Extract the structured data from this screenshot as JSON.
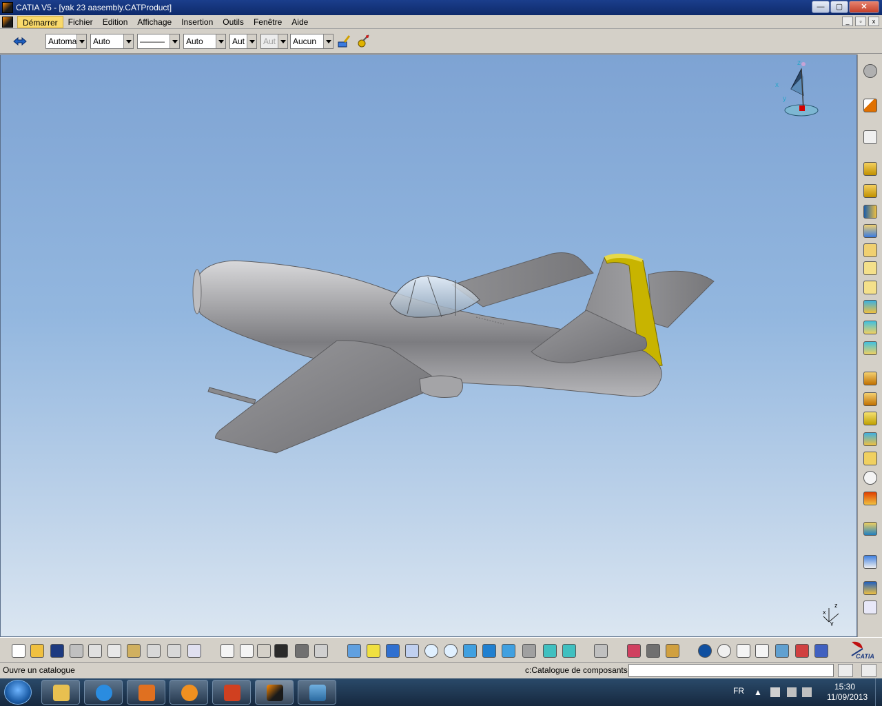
{
  "window": {
    "title": "CATIA V5 - [yak 23 aasembly.CATProduct]",
    "minimize": "—",
    "maximize": "▢",
    "close": "✕"
  },
  "menu": {
    "items": [
      "Démarrer",
      "Fichier",
      "Edition",
      "Affichage",
      "Insertion",
      "Outils",
      "Fenêtre",
      "Aide"
    ],
    "active_index": 0
  },
  "doc_controls": {
    "minimize": "_",
    "restore": "▫",
    "close": "x"
  },
  "properties": {
    "color_value": "Automa",
    "transparency_value": "Auto",
    "line_type_value": "———",
    "line_weight_value": "Auto",
    "point_value": "Aut",
    "layer_value": "Aut",
    "style_value": "Aucun"
  },
  "status": {
    "message": "Ouvre un catalogue",
    "catalog": "c:Catalogue de composants",
    "command_value": ""
  },
  "compass": {
    "x": "x",
    "y": "y",
    "z": "z"
  },
  "axis": {
    "x": "x",
    "y": "y",
    "z": "z"
  },
  "brand": "CATIA",
  "taskbar": {
    "lang": "FR",
    "time": "15:30",
    "date": "11/09/2013"
  },
  "colors": {
    "sky_top": "#7ea3d3",
    "sky_bottom": "#dbe6f1",
    "body": "#a7a7a9",
    "highlight": "#c8b400"
  }
}
